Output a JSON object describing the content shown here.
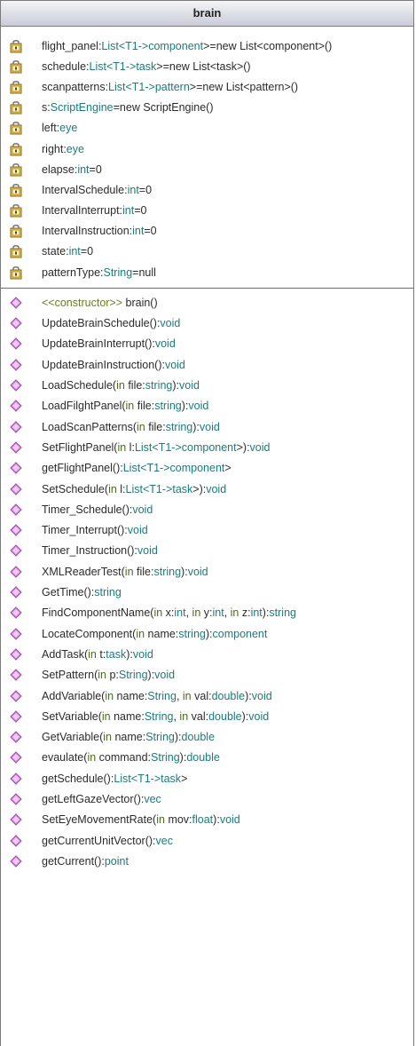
{
  "class_name": "brain",
  "attributes": [
    [
      {
        "t": "flight_panel:",
        "c": "n"
      },
      {
        "t": "List<T1->",
        "c": "t"
      },
      {
        "t": "component",
        "c": "t"
      },
      {
        "t": ">=new List<component>()",
        "c": "n"
      }
    ],
    [
      {
        "t": "schedule:",
        "c": "n"
      },
      {
        "t": "List<T1->",
        "c": "t"
      },
      {
        "t": "task",
        "c": "t"
      },
      {
        "t": ">=new List<task>()",
        "c": "n"
      }
    ],
    [
      {
        "t": "scanpatterns:",
        "c": "n"
      },
      {
        "t": "List<T1->",
        "c": "t"
      },
      {
        "t": "pattern",
        "c": "t"
      },
      {
        "t": ">=new List<pattern>()",
        "c": "n"
      }
    ],
    [
      {
        "t": "s:",
        "c": "n"
      },
      {
        "t": "ScriptEngine",
        "c": "t"
      },
      {
        "t": "=new ScriptEngine()",
        "c": "n"
      }
    ],
    [
      {
        "t": "left:",
        "c": "n"
      },
      {
        "t": "eye",
        "c": "t"
      }
    ],
    [
      {
        "t": "right:",
        "c": "n"
      },
      {
        "t": "eye",
        "c": "t"
      }
    ],
    [
      {
        "t": "elapse:",
        "c": "n"
      },
      {
        "t": "int",
        "c": "t"
      },
      {
        "t": "=0",
        "c": "n"
      }
    ],
    [
      {
        "t": "IntervalSchedule:",
        "c": "n"
      },
      {
        "t": "int",
        "c": "t"
      },
      {
        "t": "=0",
        "c": "n"
      }
    ],
    [
      {
        "t": "IntervalInterrupt:",
        "c": "n"
      },
      {
        "t": "int",
        "c": "t"
      },
      {
        "t": "=0",
        "c": "n"
      }
    ],
    [
      {
        "t": "IntervalInstruction:",
        "c": "n"
      },
      {
        "t": "int",
        "c": "t"
      },
      {
        "t": "=0",
        "c": "n"
      }
    ],
    [
      {
        "t": "state:",
        "c": "n"
      },
      {
        "t": "int",
        "c": "t"
      },
      {
        "t": "=0",
        "c": "n"
      }
    ],
    [
      {
        "t": "patternType:",
        "c": "n"
      },
      {
        "t": "String",
        "c": "t"
      },
      {
        "t": "=null",
        "c": "n"
      }
    ]
  ],
  "operations": [
    [
      {
        "t": "<<constructor>>",
        "c": "s"
      },
      {
        "t": " brain()",
        "c": "n"
      }
    ],
    [
      {
        "t": "UpdateBrainSchedule():",
        "c": "n"
      },
      {
        "t": "void",
        "c": "t"
      }
    ],
    [
      {
        "t": "UpdateBrainInterrupt():",
        "c": "n"
      },
      {
        "t": "void",
        "c": "t"
      }
    ],
    [
      {
        "t": "UpdateBrainInstruction():",
        "c": "n"
      },
      {
        "t": "void",
        "c": "t"
      }
    ],
    [
      {
        "t": "LoadSchedule(",
        "c": "n"
      },
      {
        "t": "in",
        "c": "k"
      },
      {
        "t": " file:",
        "c": "n"
      },
      {
        "t": "string",
        "c": "t"
      },
      {
        "t": "):",
        "c": "n"
      },
      {
        "t": "void",
        "c": "t"
      }
    ],
    [
      {
        "t": "LoadFilghtPanel(",
        "c": "n"
      },
      {
        "t": "in",
        "c": "k"
      },
      {
        "t": " file:",
        "c": "n"
      },
      {
        "t": "string",
        "c": "t"
      },
      {
        "t": "):",
        "c": "n"
      },
      {
        "t": "void",
        "c": "t"
      }
    ],
    [
      {
        "t": "LoadScanPatterns(",
        "c": "n"
      },
      {
        "t": "in",
        "c": "k"
      },
      {
        "t": " file:",
        "c": "n"
      },
      {
        "t": "string",
        "c": "t"
      },
      {
        "t": "):",
        "c": "n"
      },
      {
        "t": "void",
        "c": "t"
      }
    ],
    [
      {
        "t": "SetFlightPanel(",
        "c": "n"
      },
      {
        "t": "in",
        "c": "k"
      },
      {
        "t": " l:",
        "c": "n"
      },
      {
        "t": "List<T1->",
        "c": "t"
      },
      {
        "t": "component",
        "c": "t"
      },
      {
        "t": ">):",
        "c": "n"
      },
      {
        "t": "void",
        "c": "t"
      }
    ],
    [
      {
        "t": "getFlightPanel():",
        "c": "n"
      },
      {
        "t": "List<T1->",
        "c": "t"
      },
      {
        "t": "component",
        "c": "t"
      },
      {
        "t": ">",
        "c": "n"
      }
    ],
    [
      {
        "t": "SetSchedule(",
        "c": "n"
      },
      {
        "t": "in",
        "c": "k"
      },
      {
        "t": " l:",
        "c": "n"
      },
      {
        "t": "List<T1->",
        "c": "t"
      },
      {
        "t": "task",
        "c": "t"
      },
      {
        "t": ">):",
        "c": "n"
      },
      {
        "t": "void",
        "c": "t"
      }
    ],
    [
      {
        "t": "Timer_Schedule():",
        "c": "n"
      },
      {
        "t": "void",
        "c": "t"
      }
    ],
    [
      {
        "t": "Timer_Interrupt():",
        "c": "n"
      },
      {
        "t": "void",
        "c": "t"
      }
    ],
    [
      {
        "t": "Timer_Instruction():",
        "c": "n"
      },
      {
        "t": "void",
        "c": "t"
      }
    ],
    [
      {
        "t": "XMLReaderTest(",
        "c": "n"
      },
      {
        "t": "in",
        "c": "k"
      },
      {
        "t": " file:",
        "c": "n"
      },
      {
        "t": "string",
        "c": "t"
      },
      {
        "t": "):",
        "c": "n"
      },
      {
        "t": "void",
        "c": "t"
      }
    ],
    [
      {
        "t": "GetTime():",
        "c": "n"
      },
      {
        "t": "string",
        "c": "t"
      }
    ],
    [
      {
        "t": "FindComponentName(",
        "c": "n"
      },
      {
        "t": "in",
        "c": "k"
      },
      {
        "t": " x:",
        "c": "n"
      },
      {
        "t": "int",
        "c": "t"
      },
      {
        "t": ", ",
        "c": "n"
      },
      {
        "t": "in",
        "c": "k"
      },
      {
        "t": " y:",
        "c": "n"
      },
      {
        "t": "int",
        "c": "t"
      },
      {
        "t": ", ",
        "c": "n"
      },
      {
        "t": "in",
        "c": "k"
      },
      {
        "t": " z:",
        "c": "n"
      },
      {
        "t": "int",
        "c": "t"
      },
      {
        "t": "):",
        "c": "n"
      },
      {
        "t": "string",
        "c": "t"
      }
    ],
    [
      {
        "t": "LocateComponent(",
        "c": "n"
      },
      {
        "t": "in",
        "c": "k"
      },
      {
        "t": " name:",
        "c": "n"
      },
      {
        "t": "string",
        "c": "t"
      },
      {
        "t": "):",
        "c": "n"
      },
      {
        "t": "component",
        "c": "t"
      }
    ],
    [
      {
        "t": "AddTask(",
        "c": "n"
      },
      {
        "t": "in",
        "c": "k"
      },
      {
        "t": " t:",
        "c": "n"
      },
      {
        "t": "task",
        "c": "t"
      },
      {
        "t": "):",
        "c": "n"
      },
      {
        "t": "void",
        "c": "t"
      }
    ],
    [
      {
        "t": "SetPattern(",
        "c": "n"
      },
      {
        "t": "in",
        "c": "k"
      },
      {
        "t": " p:",
        "c": "n"
      },
      {
        "t": "String",
        "c": "t"
      },
      {
        "t": "):",
        "c": "n"
      },
      {
        "t": "void",
        "c": "t"
      }
    ],
    [
      {
        "t": "AddVariable(",
        "c": "n"
      },
      {
        "t": "in",
        "c": "k"
      },
      {
        "t": " name:",
        "c": "n"
      },
      {
        "t": "String",
        "c": "t"
      },
      {
        "t": ", ",
        "c": "n"
      },
      {
        "t": "in",
        "c": "k"
      },
      {
        "t": " val:",
        "c": "n"
      },
      {
        "t": "double",
        "c": "t"
      },
      {
        "t": "):",
        "c": "n"
      },
      {
        "t": "void",
        "c": "t"
      }
    ],
    [
      {
        "t": "SetVariable(",
        "c": "n"
      },
      {
        "t": "in",
        "c": "k"
      },
      {
        "t": " name:",
        "c": "n"
      },
      {
        "t": "String",
        "c": "t"
      },
      {
        "t": ", ",
        "c": "n"
      },
      {
        "t": "in",
        "c": "k"
      },
      {
        "t": " val:",
        "c": "n"
      },
      {
        "t": "double",
        "c": "t"
      },
      {
        "t": "):",
        "c": "n"
      },
      {
        "t": "void",
        "c": "t"
      }
    ],
    [
      {
        "t": "GetVariable(",
        "c": "n"
      },
      {
        "t": "in",
        "c": "k"
      },
      {
        "t": " name:",
        "c": "n"
      },
      {
        "t": "String",
        "c": "t"
      },
      {
        "t": "):",
        "c": "n"
      },
      {
        "t": "double",
        "c": "t"
      }
    ],
    [
      {
        "t": "evaulate(",
        "c": "n"
      },
      {
        "t": "in",
        "c": "k"
      },
      {
        "t": " command:",
        "c": "n"
      },
      {
        "t": "String",
        "c": "t"
      },
      {
        "t": "):",
        "c": "n"
      },
      {
        "t": "double",
        "c": "t"
      }
    ],
    [
      {
        "t": "getSchedule():",
        "c": "n"
      },
      {
        "t": "List<T1->",
        "c": "t"
      },
      {
        "t": "task",
        "c": "t"
      },
      {
        "t": ">",
        "c": "n"
      }
    ],
    [
      {
        "t": "getLeftGazeVector():",
        "c": "n"
      },
      {
        "t": "vec",
        "c": "t"
      }
    ],
    [
      {
        "t": "SetEyeMovementRate(",
        "c": "n"
      },
      {
        "t": "in",
        "c": "k"
      },
      {
        "t": " mov:",
        "c": "n"
      },
      {
        "t": "float",
        "c": "t"
      },
      {
        "t": "):",
        "c": "n"
      },
      {
        "t": "void",
        "c": "t"
      }
    ],
    [
      {
        "t": "getCurrentUnitVector():",
        "c": "n"
      },
      {
        "t": "vec",
        "c": "t"
      }
    ],
    [
      {
        "t": "getCurrent():",
        "c": "n"
      },
      {
        "t": "point",
        "c": "t"
      }
    ]
  ],
  "colors": {
    "plain": "#2b2b2b",
    "type": "#1e7a7a",
    "keyword": "#4b6a1f",
    "stereotype": "#6b7d2a",
    "attribute_icon": "#b8860b",
    "operation_icon": "#c77bd0",
    "header_gradient_top": "#f4f4f6",
    "header_gradient_bottom": "#c9ccd8"
  },
  "icons": {
    "attribute": "private-attribute-lock-icon",
    "operation": "public-operation-diamond-icon"
  }
}
